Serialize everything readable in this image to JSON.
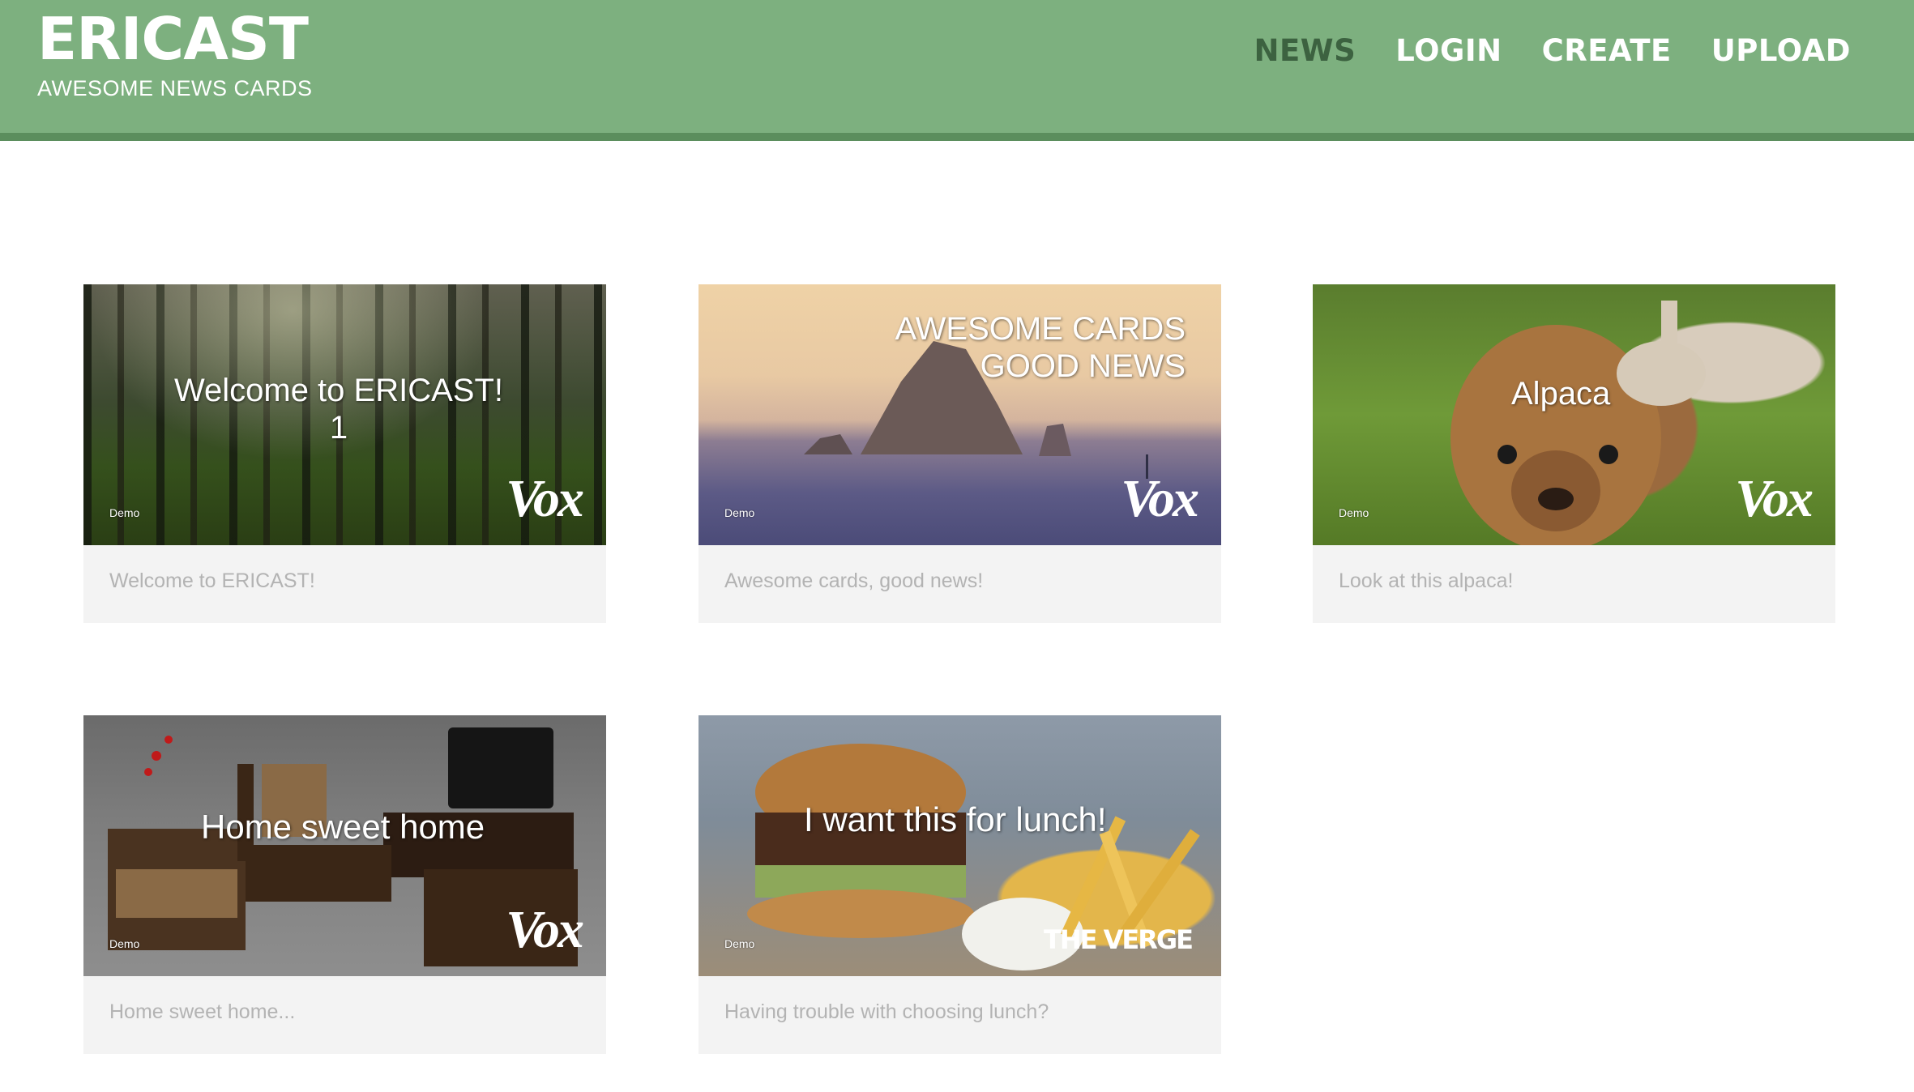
{
  "header": {
    "title": "ERICAST",
    "subtitle": "AWESOME NEWS CARDS",
    "nav": [
      {
        "label": "NEWS",
        "active": true
      },
      {
        "label": "LOGIN",
        "active": false
      },
      {
        "label": "CREATE",
        "active": false
      },
      {
        "label": "UPLOAD",
        "active": false
      }
    ]
  },
  "colors": {
    "header_bg": "#7db07f",
    "header_border": "#5b8e5d",
    "nav_active": "#3c6240",
    "card_bg": "#f3f3f3",
    "caption": "#b3b3b3"
  },
  "cards": [
    {
      "overlay_title": "Welcome to ERICAST!",
      "overlay_title_line2": "1",
      "tag": "Demo",
      "source_logo": "Vox",
      "caption": "Welcome to ERICAST!"
    },
    {
      "overlay_title": "AWESOME CARDS",
      "overlay_title_line2": "GOOD NEWS",
      "tag": "Demo",
      "source_logo": "Vox",
      "caption": "Awesome cards, good news!"
    },
    {
      "overlay_title": "Alpaca",
      "tag": "Demo",
      "source_logo": "Vox",
      "caption": "Look at this alpaca!"
    },
    {
      "overlay_title": "Home sweet home",
      "tag": "Demo",
      "source_logo": "Vox",
      "caption": "Home sweet home..."
    },
    {
      "overlay_title": "I want this for lunch!",
      "tag": "Demo",
      "source_logo": "THE VERGE",
      "caption": "Having trouble with choosing lunch?"
    }
  ]
}
